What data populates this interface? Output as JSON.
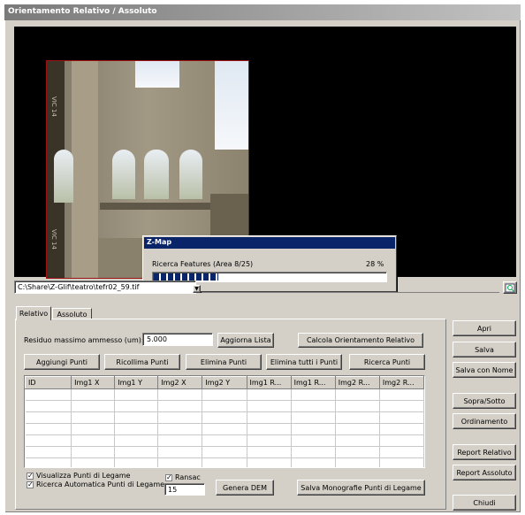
{
  "window": {
    "title": "Orientamento Relativo / Assoluto"
  },
  "photo": {
    "side_text_1": "VIC 14",
    "side_text_2": "VIC 14"
  },
  "path_bar": {
    "path": "C:\\Share\\Z-Glif\\teatro\\tefr02_59.tif"
  },
  "progress_dialog": {
    "title": "Z-Map",
    "message": "Ricerca Features (Area 8/25)",
    "percent": "28 %",
    "progress_fraction": 0.28
  },
  "tabs": [
    {
      "label": "Relativo"
    },
    {
      "label": "Assoluto"
    }
  ],
  "relativo": {
    "residuo_label": "Residuo massimo ammesso (um):",
    "residuo_value": "5.000",
    "aggiorna_lista": "Aggiorna Lista",
    "calcola": "Calcola Orientamento Relativo",
    "aggiungi_punti": "Aggiungi Punti",
    "ricollima_punti": "Ricollima Punti",
    "elimina_punti": "Elimina Punti",
    "elimina_tutti": "Elimina tutti i Punti",
    "ricerca_punti": "Ricerca Punti",
    "columns": [
      "ID",
      "Img1 X",
      "Img1 Y",
      "Img2 X",
      "Img2 Y",
      "Img1 R...",
      "Img1 R...",
      "Img2 R...",
      "Img2 R..."
    ],
    "visualizza_label": "Visualizza Punti di Legame",
    "ricerca_auto_label": "Ricerca Automatica Punti di Legame",
    "ransac_label": "Ransac",
    "ransac_value": "15",
    "genera_dem": "Genera DEM",
    "salva_monografie": "Salva Monografie Punti di Legame"
  },
  "side_buttons": {
    "apri": "Apri",
    "salva": "Salva",
    "salva_con_nome": "Salva con Nome",
    "sopra_sotto": "Sopra/Sotto",
    "ordinamento": "Ordinamento",
    "report_relativo": "Report Relativo",
    "report_assoluto": "Report Assoluto",
    "chiudi": "Chiudi"
  }
}
